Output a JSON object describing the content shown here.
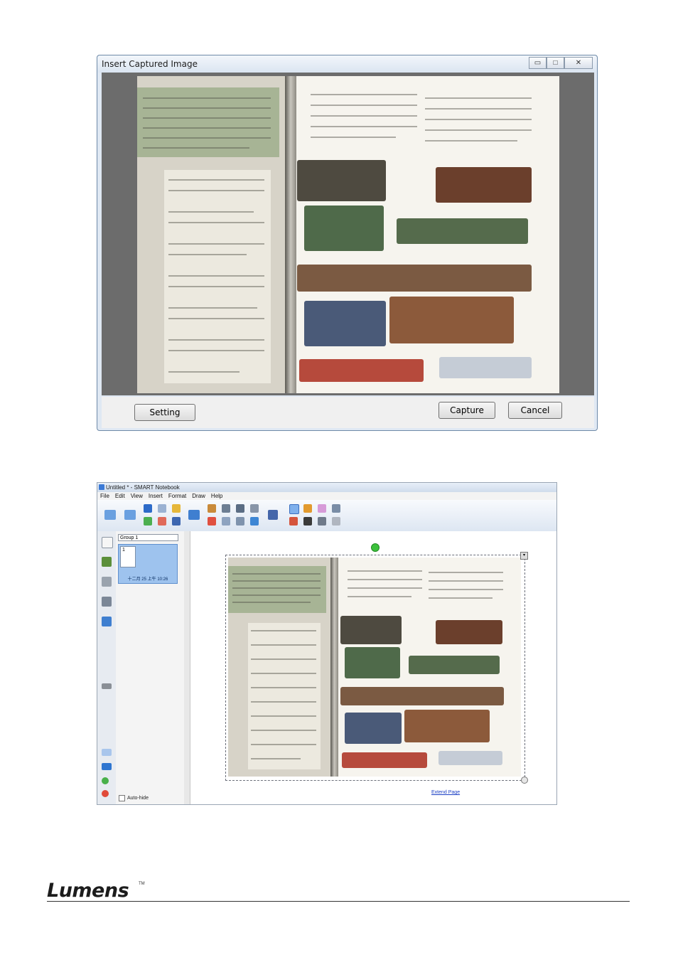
{
  "dialog": {
    "title": "Insert Captured Image",
    "buttons": {
      "setting": "Setting",
      "capture": "Capture",
      "cancel": "Cancel"
    },
    "window_controls": {
      "minimize": "▭",
      "maximize": "□",
      "close": "✕"
    }
  },
  "notebook": {
    "title": "Untitled * - SMART Notebook",
    "menu": [
      "File",
      "Edit",
      "View",
      "Insert",
      "Format",
      "Draw",
      "Help"
    ],
    "group": "Group 1",
    "page_number": "1",
    "page_date": "十二月 25 上午 10:26",
    "auto_hide": "Auto-hide",
    "extend_page": "Extend Page"
  },
  "footer": {
    "logo": "Lumens",
    "tm": "TM"
  },
  "colors": {
    "accent": "#3b7ad6",
    "dialog_border": "#6e8aa8",
    "link": "#1b3fc4"
  }
}
